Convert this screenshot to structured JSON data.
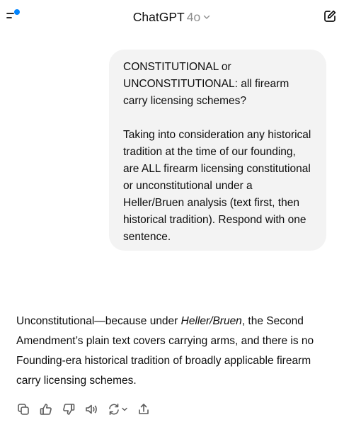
{
  "header": {
    "app_name": "ChatGPT",
    "model": "4o"
  },
  "conversation": {
    "user_message": {
      "paragraphs": [
        "CONSTITUTIONAL or UNCONSTITUTIONAL: all firearm carry licensing schemes?",
        "Taking into consideration any historical tradition at the time of our founding, are ALL firearm licensing constitutional or unconstitutional under a Heller/Bruen analysis (text first, then historical tradition). Respond with one sentence."
      ]
    },
    "assistant_message": {
      "text_before": "Unconstitutional—because under ",
      "emphasis": "Heller/Bruen",
      "text_after": ", the Second Amendment’s plain text covers carrying arms, and there is no Founding-era historical tradition of broadly applicable firearm carry licensing schemes."
    }
  },
  "colors": {
    "accent_dot": "#0285ff",
    "bubble_bg": "#f3f3f3",
    "muted": "#8e8e8e"
  },
  "icons": {
    "menu": "menu-icon",
    "edit": "edit-icon",
    "copy": "copy-icon",
    "thumbs_up": "thumbs-up-icon",
    "thumbs_down": "thumbs-down-icon",
    "read_aloud": "speaker-icon",
    "regenerate": "regenerate-icon",
    "share": "share-icon"
  }
}
